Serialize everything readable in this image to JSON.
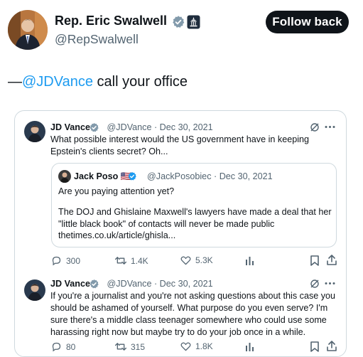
{
  "main_tweet": {
    "author_name": "Rep. Eric Swalwell",
    "handle": "@RepSwalwell",
    "follow_label": "Follow back",
    "text_prefix": "—",
    "text_mention": "@JDVance",
    "text_suffix": " call your office"
  },
  "quoted_thread": {
    "tweet1": {
      "author_name": "JD Vance",
      "handle": "@JDVance",
      "separator": "·",
      "date": "Dec 30, 2021",
      "text": "What possible interest would the US government have in keeping Epstein's clients secret? Oh...",
      "stats": {
        "replies": "300",
        "retweets": "1.4K",
        "likes": "5.3K"
      }
    },
    "inner_quote": {
      "author_name": "Jack Poso",
      "flag": "🇺🇸",
      "handle": "@JackPosobiec",
      "separator": "·",
      "date": "Dec 30, 2021",
      "line1": "Are you paying attention yet?",
      "line2": "The DOJ and Ghislaine Maxwell's lawyers have made a deal that her \"little black book\" of contacts will never be made public",
      "line3": "thetimes.co.uk/article/ghisla..."
    },
    "tweet2": {
      "author_name": "JD Vance",
      "handle": "@JDVance",
      "separator": "·",
      "date": "Dec 30, 2021",
      "text": "If you're a journalist and you're not asking questions about this case you should be ashamed of yourself. What purpose do you even serve? I'm sure there's a middle class teenager somewhere who could use some harassing right now but maybe try to do your job once in a while.",
      "stats": {
        "replies": "80",
        "retweets": "315",
        "likes": "1.8K"
      }
    }
  },
  "colors": {
    "link": "#1d9bf0",
    "text": "#0f1419",
    "muted": "#536471",
    "border": "#cfd9de",
    "verified_gray": "#829aab",
    "verified_blue": "#1d9bf0",
    "gov_badge": "#1f2d3d"
  },
  "icons": [
    "verified-gray-icon",
    "government-badge-icon",
    "verified-blue-icon",
    "grok-icon",
    "more-icon",
    "reply-icon",
    "retweet-icon",
    "like-icon",
    "views-icon",
    "bookmark-icon",
    "share-icon"
  ]
}
